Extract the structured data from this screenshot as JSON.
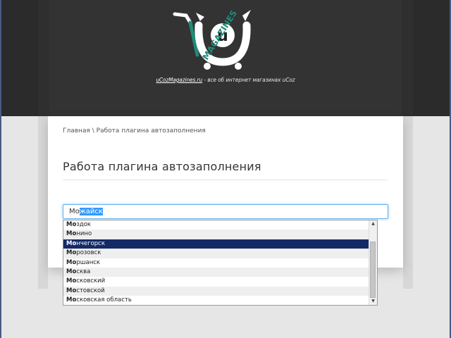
{
  "header": {
    "logo": {
      "letter": "u",
      "word": "MAGAZINES"
    },
    "tagline_link": "uCozMagazines.ru",
    "tagline_rest": " - все об интернет магазинах uCoz"
  },
  "breadcrumb": {
    "home": "Главная",
    "separator": " \\ ",
    "current": "Работа плагина автозаполнения"
  },
  "page": {
    "title": "Работа плагина автозаполнения"
  },
  "city_input": {
    "typed": "Мо",
    "selected_suggestion": "жайск"
  },
  "suggestions": {
    "match_prefix": "Мо",
    "items": [
      {
        "rest": "здок",
        "active": false
      },
      {
        "rest": "нино",
        "active": false
      },
      {
        "rest": "нчегорск",
        "active": true
      },
      {
        "rest": "розовск",
        "active": false
      },
      {
        "rest": "ршанск",
        "active": false
      },
      {
        "rest": "сква",
        "active": false
      },
      {
        "rest": "сковский",
        "active": false
      },
      {
        "rest": "стовской",
        "active": false
      },
      {
        "rest": "сковская область",
        "active": false
      }
    ]
  },
  "colors": {
    "header_bg": "#333333",
    "active_item": "#142a66",
    "input_focus": "#66afe9"
  }
}
